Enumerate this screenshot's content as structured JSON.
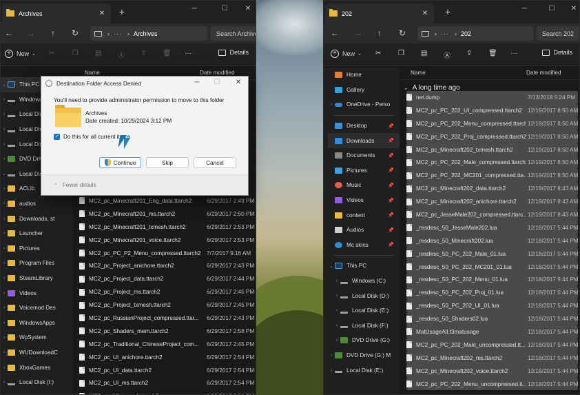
{
  "colors": {
    "folder": "#e8b93a",
    "accent": "#1f6fc6",
    "window_bg": "#191919",
    "selected_row": "#4a4a4a"
  },
  "left": {
    "tab_title": "Archives",
    "address_path": "Archives",
    "search_placeholder": "Search Archive",
    "new_label": "New",
    "details_label": "Details",
    "col_name": "Name",
    "col_date": "Date modified",
    "sidebar": [
      {
        "label": "This PC",
        "icon": "pc-icon",
        "chev": "⌄",
        "active": true,
        "top": true
      },
      {
        "label": "Windows (C:)",
        "icon": "drive-icon",
        "chev": "›"
      },
      {
        "label": "Local Disk (D:)",
        "icon": "drive-icon",
        "chev": "›"
      },
      {
        "label": "Local Disk (E:)",
        "icon": "drive-icon",
        "chev": "›"
      },
      {
        "label": "Local Disk (F:)",
        "icon": "drive-icon",
        "chev": "›"
      },
      {
        "label": "DVD Drive (G:)",
        "icon": "dvd-icon",
        "chev": "›"
      },
      {
        "label": "Local Disk (H:)",
        "icon": "drive-icon",
        "chev": "⌄"
      },
      {
        "label": "ACLib",
        "icon": "folder-icon",
        "chev": "›"
      },
      {
        "label": "audios",
        "icon": "folder-icon",
        "chev": "›"
      },
      {
        "label": "Downloads, st",
        "icon": "folder-icon",
        "chev": "›"
      },
      {
        "label": "Launcher",
        "icon": "folder-icon",
        "chev": "›"
      },
      {
        "label": "Pictures",
        "icon": "folder-icon",
        "chev": "›"
      },
      {
        "label": "Program Files",
        "icon": "folder-icon",
        "chev": "›"
      },
      {
        "label": "SteamLibrary",
        "icon": "folder-icon",
        "chev": "›"
      },
      {
        "label": "Videos",
        "icon": "videos-icon",
        "chev": "›"
      },
      {
        "label": "Voicemod Des",
        "icon": "folder-icon",
        "chev": "›"
      },
      {
        "label": "WindowsApps",
        "icon": "folder-icon",
        "chev": "›"
      },
      {
        "label": "WpSystem",
        "icon": "folder-icon",
        "chev": "›"
      },
      {
        "label": "WUDownloadC",
        "icon": "folder-icon",
        "chev": "›"
      },
      {
        "label": "XboxGames",
        "icon": "folder-icon",
        "chev": "›"
      },
      {
        "label": "Local Disk (I:)",
        "icon": "drive-icon",
        "chev": "›"
      }
    ],
    "files": [
      {
        "name": "MC2_pc_Minecraft201_Eng_data.ttarch2",
        "date": "6/29/2017 2:49 PM"
      },
      {
        "name": "MC2_pc_Minecraft201_ms.ttarch2",
        "date": "6/29/2017 2:50 PM"
      },
      {
        "name": "MC2_pc_Minecraft201_txmesh.ttarch2",
        "date": "6/29/2017 2:53 PM"
      },
      {
        "name": "MC2_pc_Minecraft201_voice.ttarch2",
        "date": "6/29/2017 2:53 PM"
      },
      {
        "name": "MC2_pc_PC_P2_Menu_compressed.ttarch2",
        "date": "7/7/2017 9:16 AM"
      },
      {
        "name": "MC2_pc_Project_anichore.ttarch2",
        "date": "6/29/2017 2:43 PM"
      },
      {
        "name": "MC2_pc_Project_data.ttarch2",
        "date": "6/29/2017 2:44 PM"
      },
      {
        "name": "MC2_pc_Project_ms.ttarch2",
        "date": "6/29/2017 2:45 PM"
      },
      {
        "name": "MC2_pc_Project_txmesh.ttarch2",
        "date": "6/29/2017 2:45 PM"
      },
      {
        "name": "MC2_pc_RussianProject_compressed.ttar...",
        "date": "6/29/2017 2:43 PM"
      },
      {
        "name": "MC2_pc_Shaders_mem.ttarch2",
        "date": "6/29/2017 2:58 PM"
      },
      {
        "name": "MC2_pc_Traditional_ChineseProject_com...",
        "date": "6/29/2017 2:45 PM"
      },
      {
        "name": "MC2_pc_UI_anichore.ttarch2",
        "date": "6/29/2017 2:54 PM"
      },
      {
        "name": "MC2_pc_UI_data.ttarch2",
        "date": "6/29/2017 2:54 PM"
      },
      {
        "name": "MC2_pc_UI_ms.ttarch2",
        "date": "6/29/2017 2:54 PM"
      },
      {
        "name": "MC2_pc_UI_txmesh.ttarch2",
        "date": "6/29/2017 2:54 PM"
      }
    ]
  },
  "right": {
    "tab_title": "202",
    "address_path": "202",
    "search_placeholder": "Search 202",
    "new_label": "New",
    "details_label": "Details",
    "col_name": "Name",
    "col_date": "Date modified",
    "group_label": "A long time ago",
    "sidebar": [
      {
        "label": "Home",
        "icon": "home-icon"
      },
      {
        "label": "Gallery",
        "icon": "gallery-icon"
      },
      {
        "label": "OneDrive - Perso",
        "icon": "onedrive-icon",
        "chev": "›"
      },
      {
        "sep": true
      },
      {
        "label": "Desktop",
        "icon": "desktop-icon",
        "pin": true
      },
      {
        "label": "Downloads",
        "icon": "downloads-icon",
        "pin": true,
        "active": true
      },
      {
        "label": "Documents",
        "icon": "documents-icon",
        "pin": true
      },
      {
        "label": "Pictures",
        "icon": "pictures-icon",
        "pin": true
      },
      {
        "label": "Music",
        "icon": "music-icon",
        "pin": true
      },
      {
        "label": "Videos",
        "icon": "videos-icon",
        "pin": true
      },
      {
        "label": "content",
        "icon": "folder-icon",
        "pin": true
      },
      {
        "label": "Audios",
        "icon": "audios-icon",
        "pin": true
      },
      {
        "label": "Mc skins",
        "icon": "mc-skins-icon",
        "pin": true
      },
      {
        "sep": true
      },
      {
        "label": "This PC",
        "icon": "pc-icon",
        "chev": "⌄"
      },
      {
        "label": "Windows (C:)",
        "icon": "drive-icon",
        "chev": "›",
        "indent": true
      },
      {
        "label": "Local Disk (D:)",
        "icon": "drive-icon",
        "chev": "›",
        "indent": true
      },
      {
        "label": "Local Disk (E:)",
        "icon": "drive-icon",
        "chev": "›",
        "indent": true
      },
      {
        "label": "Local Disk (F:)",
        "icon": "drive-icon",
        "chev": "›",
        "indent": true
      },
      {
        "label": "DVD Drive (G:)",
        "icon": "dvd-icon",
        "chev": "›",
        "indent": true
      },
      {
        "label": "DVD Drive (G:) M",
        "icon": "dvd-icon",
        "chev": "›"
      },
      {
        "label": "Local Disk (E:)",
        "icon": "drive-icon",
        "chev": "›"
      }
    ],
    "files": [
      {
        "name": "net.dump",
        "date": "7/13/2018 5:24 PM"
      },
      {
        "name": "MC2_pc_PC_202_UI_compressed.ttarch2",
        "date": "12/19/2017 8:50 AM"
      },
      {
        "name": "MC2_pc_PC_202_Menu_compressed.ttarch2",
        "date": "12/19/2017 8:50 AM"
      },
      {
        "name": "MC2_pc_PC_202_Proj_compressed.ttarch2",
        "date": "12/19/2017 8:50 AM"
      },
      {
        "name": "MC2_pc_Minecraft202_txmesh.ttarch2",
        "date": "12/19/2017 8:50 AM"
      },
      {
        "name": "MC2_pc_PC_202_Male_compressed.ttarch2",
        "date": "12/19/2017 8:50 AM"
      },
      {
        "name": "MC2_pc_PC_202_MC201_compressed.tta...",
        "date": "12/19/2017 8:50 AM"
      },
      {
        "name": "MC2_pc_Minecraft202_data.ttarch2",
        "date": "12/19/2017 8:43 AM"
      },
      {
        "name": "MC2_pc_Minecraft202_anichore.ttarch2",
        "date": "12/19/2017 8:43 AM"
      },
      {
        "name": "MC2_pc_JesseMale202_compressed.ttarc...",
        "date": "12/19/2017 8:43 AM"
      },
      {
        "name": "_resdesc_50_JesseMale202.lua",
        "date": "12/18/2017 5:44 PM"
      },
      {
        "name": "_resdesc_50_Minecraft202.lua",
        "date": "12/18/2017 5:44 PM"
      },
      {
        "name": "_resdesc_50_PC_202_Male_01.lua",
        "date": "12/18/2017 5:44 PM"
      },
      {
        "name": "_resdesc_50_PC_202_MC201_01.lua",
        "date": "12/18/2017 5:44 PM"
      },
      {
        "name": "_resdesc_50_PC_202_Menu_01.lua",
        "date": "12/18/2017 5:44 PM"
      },
      {
        "name": "_resdesc_50_PC_202_Proj_01.lua",
        "date": "12/18/2017 5:44 PM"
      },
      {
        "name": "_resdesc_50_PC_202_UI_01.lua",
        "date": "12/18/2017 5:44 PM"
      },
      {
        "name": "_resdesc_50_Shaders02.lua",
        "date": "12/18/2017 5:44 PM"
      },
      {
        "name": "MatUsageAll.t3matusage",
        "date": "12/18/2017 5:44 PM"
      },
      {
        "name": "MC2_pc_PC_202_Male_uncompressed.tt...",
        "date": "12/18/2017 5:44 PM"
      },
      {
        "name": "MC2_pc_Minecraft202_ms.ttarch2",
        "date": "12/18/2017 5:44 PM"
      },
      {
        "name": "MC2_pc_Minecraft202_voice.ttarch2",
        "date": "12/18/2017 5:44 PM"
      },
      {
        "name": "MC2_pc_PC_202_Menu_uncompressed.tt...",
        "date": "12/18/2017 5:44 PM"
      }
    ]
  },
  "dialog": {
    "title": "Destination Folder Access Denied",
    "message": "You'll need to provide administrator permission to move to this folder",
    "folder_name": "Archives",
    "folder_date": "Date created: 10/29/2024 3:12 PM",
    "checkbox_label": "Do this for all current items",
    "continue_label": "Continue",
    "skip_label": "Skip",
    "cancel_label": "Cancel",
    "fewer_details": "Fewer details"
  }
}
